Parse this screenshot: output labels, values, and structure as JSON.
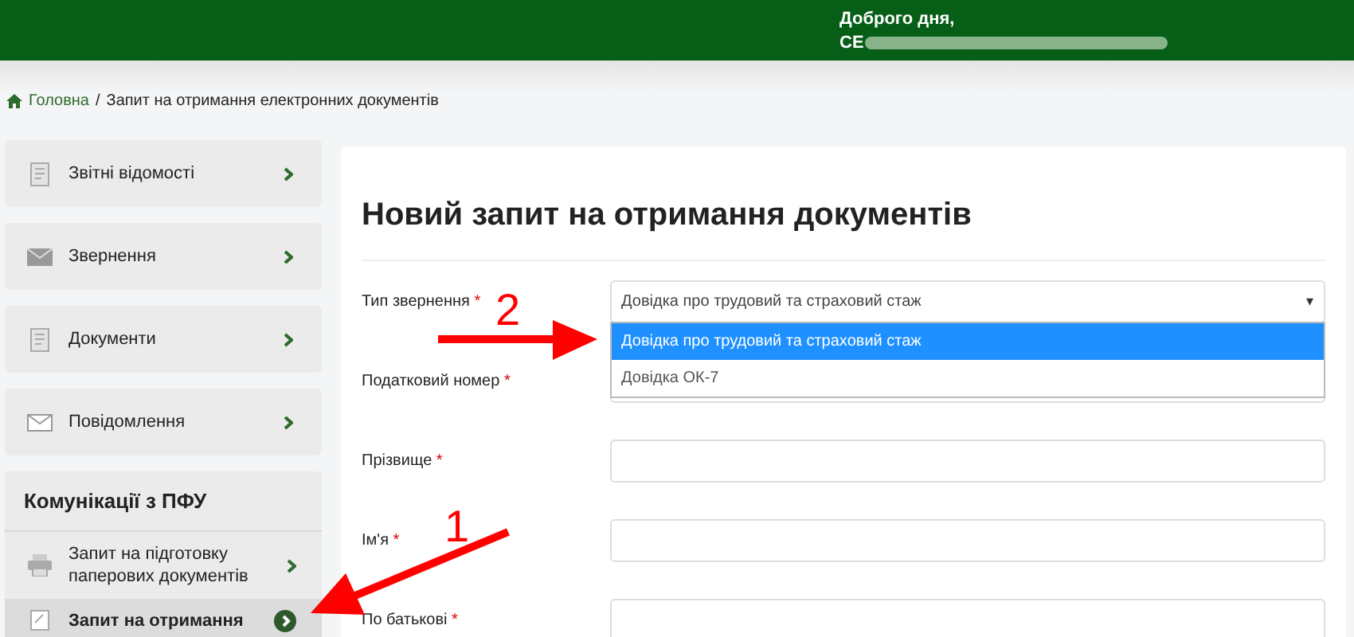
{
  "header": {
    "greeting": "Доброго дня,",
    "user_name": "СЕ"
  },
  "breadcrumb": {
    "home": "Головна",
    "separator": "/",
    "current": "Запит на отримання електронних документів"
  },
  "sidebar": {
    "items": [
      {
        "label": "Звітні відомості",
        "kind": "document"
      },
      {
        "label": "Звернення",
        "kind": "mail"
      },
      {
        "label": "Документи",
        "kind": "document"
      },
      {
        "label": "Повідомлення",
        "kind": "mail-outline"
      }
    ],
    "section": {
      "title": "Комунікації з ПФУ",
      "items": [
        {
          "label": "Запит на підготовку паперових документів",
          "kind": "printer",
          "selected": false
        },
        {
          "label": "Запит на отримання",
          "kind": "form",
          "selected": true
        }
      ]
    }
  },
  "form": {
    "title": "Новий запит на отримання документів",
    "fields": [
      {
        "label": "Тип звернення",
        "required": "*",
        "kind": "select",
        "value": "Довідка про трудовий та страховий стаж",
        "arrow": "▾",
        "expanded": true,
        "options": [
          {
            "label": "Довідка про трудовий та страховий стаж",
            "selected": true
          },
          {
            "label": "Довідка ОК-7",
            "selected": false
          }
        ]
      },
      {
        "label": "Податковий номер",
        "required": "*",
        "kind": "text"
      },
      {
        "label": "Прізвище",
        "required": "*",
        "kind": "text"
      },
      {
        "label": "Ім'я",
        "required": "*",
        "kind": "text"
      },
      {
        "label": "По батькові",
        "required": "*",
        "kind": "text"
      }
    ]
  },
  "annotations": [
    {
      "label": "2",
      "kind": "right"
    },
    {
      "label": "1",
      "kind": "down-left"
    }
  ]
}
